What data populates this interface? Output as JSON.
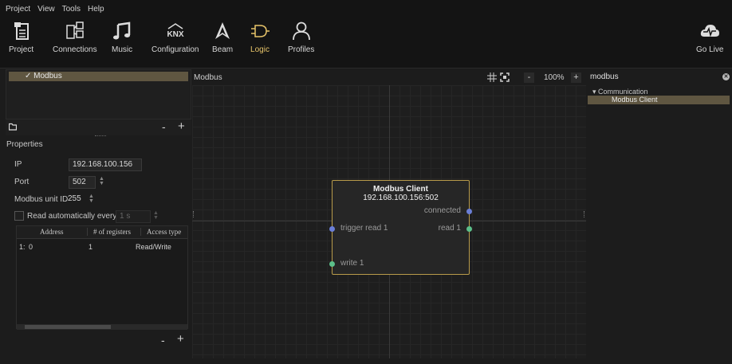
{
  "menu": [
    "Project",
    "View",
    "Tools",
    "Help"
  ],
  "toolbar": {
    "items": [
      {
        "label": "Project",
        "icon": "project-icon"
      },
      {
        "label": "Connections",
        "icon": "connections-icon"
      },
      {
        "label": "Music",
        "icon": "music-icon"
      },
      {
        "label": "Configuration",
        "icon": "knx-icon"
      },
      {
        "label": "Beam",
        "icon": "beam-icon"
      },
      {
        "label": "Logic",
        "icon": "logic-icon",
        "active": true
      },
      {
        "label": "Profiles",
        "icon": "profiles-icon"
      }
    ],
    "go_live": "Go Live",
    "knx_text": "KNX"
  },
  "tree": {
    "item": "✓ Modbus"
  },
  "tree_actions": {
    "minus": "-",
    "plus": "+"
  },
  "properties": {
    "title": "Properties",
    "ip_label": "IP",
    "ip_value": "192.168.100.156",
    "port_label": "Port",
    "port_value": "502",
    "unit_label": "Modbus unit ID",
    "unit_value": "255",
    "read_auto_label": "Read automatically every",
    "read_auto_value": "1 s",
    "table": {
      "columns": [
        "Address",
        "# of registers",
        "Access type"
      ],
      "rows": [
        {
          "index": "1:",
          "address": "0",
          "registers": "1",
          "access": "Read/Write"
        }
      ]
    }
  },
  "canvas": {
    "title": "Modbus",
    "zoom": "100%",
    "zoom_minus": "-",
    "zoom_plus": "+",
    "node": {
      "title": "Modbus Client",
      "subtitle": "192.168.100.156:502",
      "inputs": [
        "trigger read 1",
        "write 1"
      ],
      "outputs": [
        "connected",
        "read 1"
      ]
    }
  },
  "library": {
    "search": "modbus",
    "category": "▾  Communication",
    "item": "Modbus Client"
  },
  "colors": {
    "accent": "#e8c56a",
    "node_border": "#b89b4a",
    "selection": "#5f5641",
    "port_blue": "#6b7fd7",
    "port_green": "#5cc08a"
  }
}
